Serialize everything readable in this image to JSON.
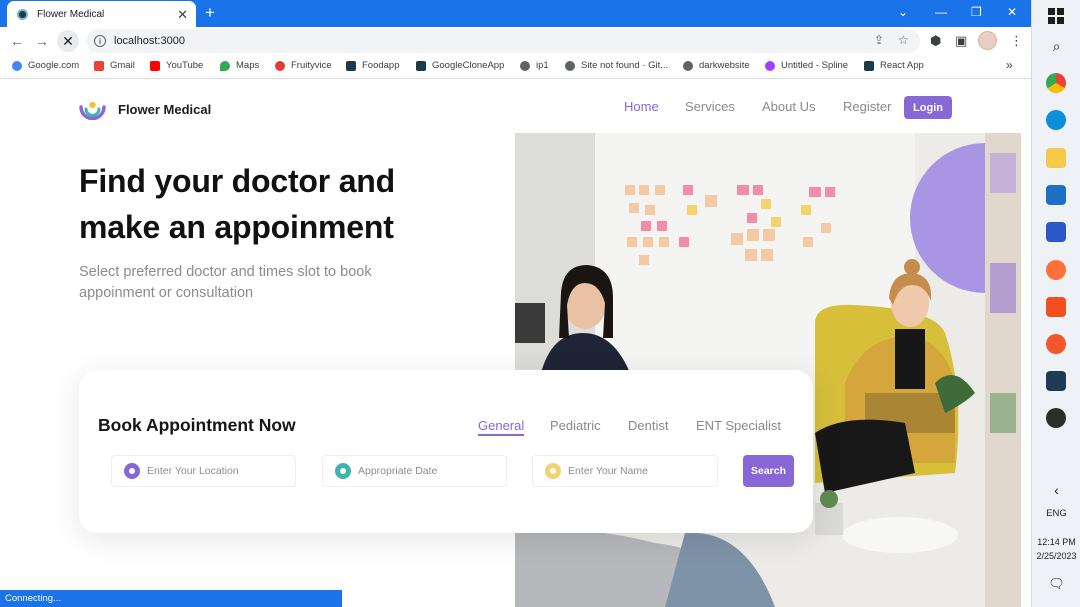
{
  "browser": {
    "tab": {
      "title": "Flower Medical"
    },
    "url": "localhost:3000",
    "bookmarks": [
      {
        "label": "Google.com",
        "icon": "google-icon",
        "color": "#4285f4"
      },
      {
        "label": "Gmail",
        "icon": "gmail-icon",
        "color": "#ea4335"
      },
      {
        "label": "YouTube",
        "icon": "youtube-icon",
        "color": "#ff0000"
      },
      {
        "label": "Maps",
        "icon": "maps-icon",
        "color": "#34a853"
      },
      {
        "label": "Fruityvice",
        "icon": "fruit-icon",
        "color": "#e53935"
      },
      {
        "label": "Foodapp",
        "icon": "react-icon",
        "color": "#1b3a4b"
      },
      {
        "label": "GoogleCloneApp",
        "icon": "react-icon",
        "color": "#1b3a4b"
      },
      {
        "label": "ip1",
        "icon": "globe-icon",
        "color": "#5f6368"
      },
      {
        "label": "Site not found · Git...",
        "icon": "globe-icon",
        "color": "#5f6368"
      },
      {
        "label": "darkwebsite",
        "icon": "globe-icon",
        "color": "#5f6368"
      },
      {
        "label": "Untitled - Spline",
        "icon": "spline-icon",
        "color": "#a040ff"
      },
      {
        "label": "React App",
        "icon": "react-icon",
        "color": "#1b3a4b"
      }
    ],
    "status": "Connecting..."
  },
  "site": {
    "brand": "Flower Medical",
    "nav": [
      {
        "label": "Home",
        "active": true
      },
      {
        "label": "Services",
        "active": false
      },
      {
        "label": "About Us",
        "active": false
      },
      {
        "label": "Register",
        "active": false
      }
    ],
    "login": "Login",
    "hero": {
      "title_line1": "Find your doctor and",
      "title_line2": "make an appoinment",
      "subtitle": "Select preferred doctor and times slot to book appoinment or consultation"
    },
    "booking": {
      "title": "Book Appointment Now",
      "tabs": [
        "General",
        "Pediatric",
        "Dentist",
        "ENT Specialist"
      ],
      "active_tab": "General",
      "fields": [
        {
          "placeholder": "Enter Your Location",
          "color": "#8867d6"
        },
        {
          "placeholder": "Appropriate Date",
          "color": "#3fb3ad"
        },
        {
          "placeholder": "Enter Your Name",
          "color": "#f3d36b"
        }
      ],
      "search": "Search"
    }
  },
  "taskbar": {
    "lang": "ENG",
    "time": "12:14 PM",
    "date": "2/25/2023"
  },
  "colors": {
    "accent": "#8867d6",
    "chrome_blue": "#1a73e8"
  }
}
